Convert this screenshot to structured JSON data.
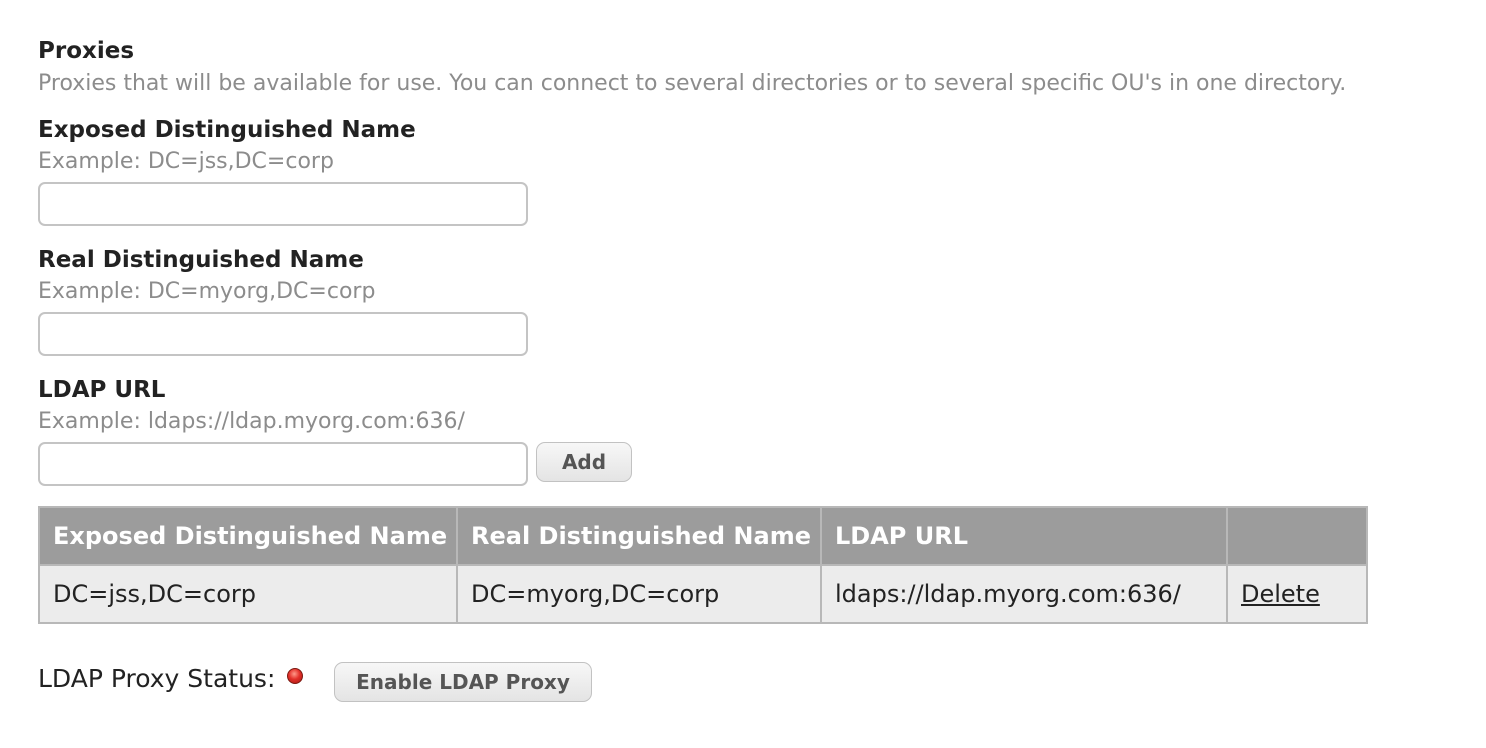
{
  "proxies": {
    "title": "Proxies",
    "description": "Proxies that will be available for use. You can connect to several directories or to several specific OU's in one directory."
  },
  "exposed_dn": {
    "label": "Exposed Distinguished Name",
    "example": "Example: DC=jss,DC=corp",
    "value": ""
  },
  "real_dn": {
    "label": "Real Distinguished Name",
    "example": "Example: DC=myorg,DC=corp",
    "value": ""
  },
  "ldap_url": {
    "label": "LDAP URL",
    "example": "Example: ldaps://ldap.myorg.com:636/",
    "value": ""
  },
  "add_button_label": "Add",
  "table": {
    "columns": [
      "Exposed Distinguished Name",
      "Real Distinguished Name",
      "LDAP URL",
      ""
    ],
    "rows": [
      {
        "exposed_dn": "DC=jss,DC=corp",
        "real_dn": "DC=myorg,DC=corp",
        "ldap_url": "ldaps://ldap.myorg.com:636/",
        "action": "Delete"
      }
    ]
  },
  "status": {
    "label": "LDAP Proxy Status:",
    "indicator_color": "#e3302a",
    "indicator_icon": "red-status-light",
    "button_label": "Enable LDAP Proxy"
  }
}
